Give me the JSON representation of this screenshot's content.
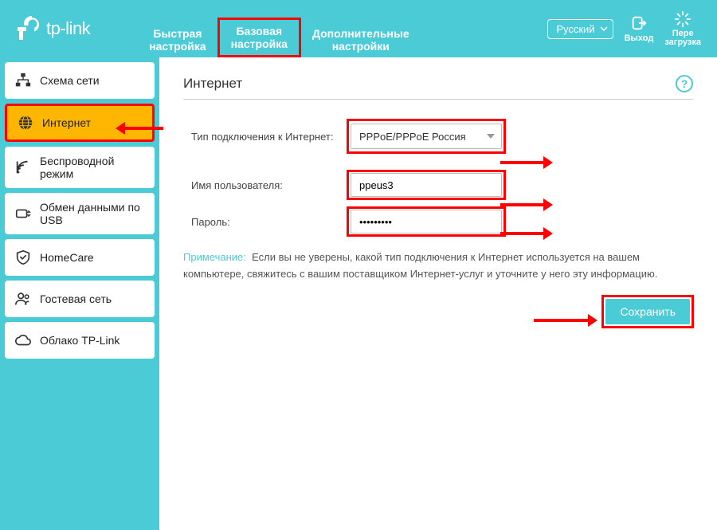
{
  "brand": "tp-link",
  "header": {
    "tabs": [
      {
        "label_line1": "Быстрая",
        "label_line2": "настройка"
      },
      {
        "label_line1": "Базовая",
        "label_line2": "настройка"
      },
      {
        "label_line1": "Дополнительные",
        "label_line2": "настройки"
      }
    ],
    "logout_label": "Выход",
    "reload_label": "Пере\nзагрузка",
    "language": "Русский"
  },
  "sidebar": {
    "items": [
      {
        "label": "Схема сети"
      },
      {
        "label": "Интернет"
      },
      {
        "label": "Беспроводной режим"
      },
      {
        "label": "Обмен данными по USB"
      },
      {
        "label": "HomeCare"
      },
      {
        "label": "Гостевая сеть"
      },
      {
        "label": "Облако TP-Link"
      }
    ]
  },
  "main": {
    "title": "Интернет",
    "connection_type_label": "Тип подключения к Интернет:",
    "connection_type_value": "PPPoE/PPPoE Россия",
    "username_label": "Имя пользователя:",
    "username_value": "ppeus3",
    "password_label": "Пароль:",
    "password_value": "•••••••••",
    "note_label": "Примечание:",
    "note_text": "Если вы не уверены, какой тип подключения к Интернет используется на вашем компьютере, свяжитесь с вашим поставщиком Интернет-услуг и уточните у него эту информацию.",
    "save_label": "Сохранить"
  }
}
